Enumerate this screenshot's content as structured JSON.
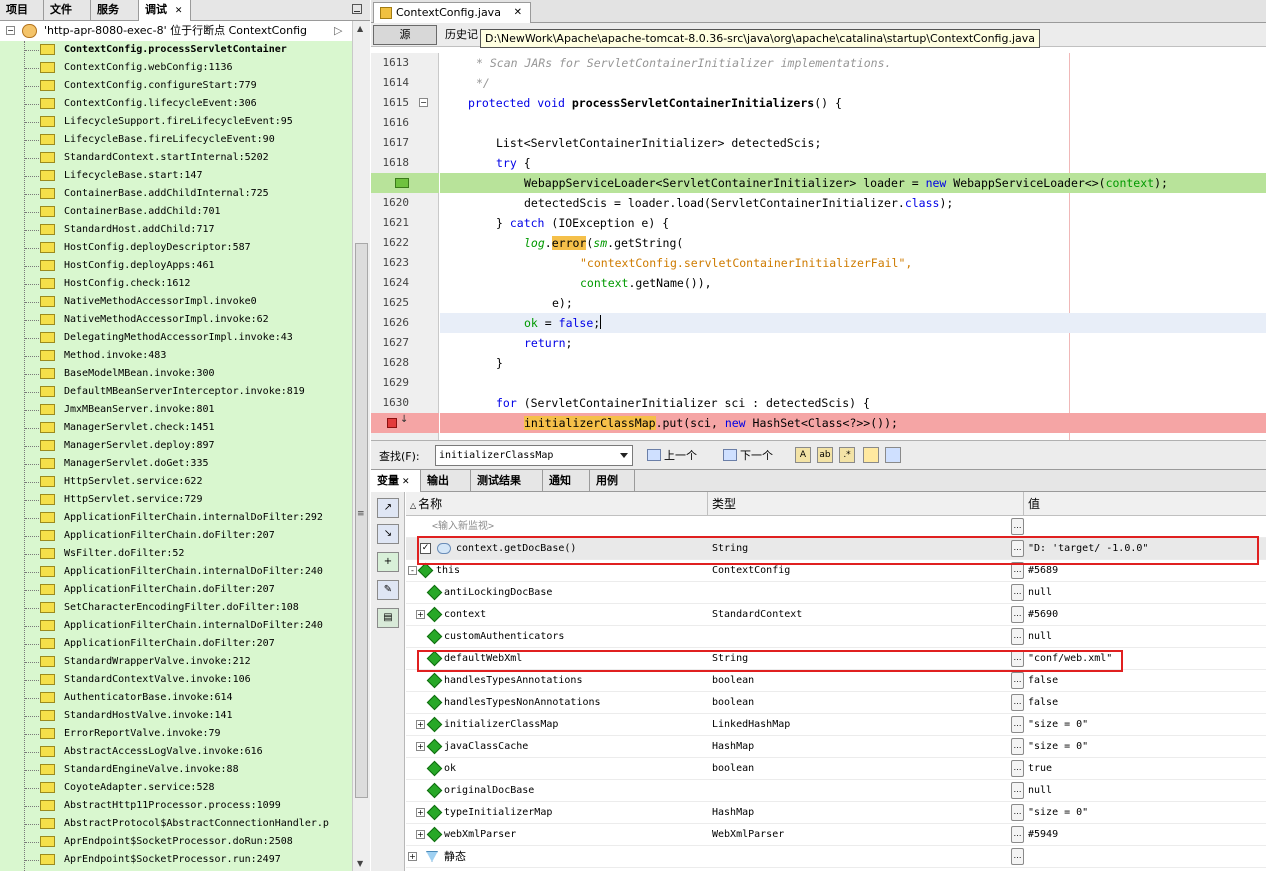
{
  "left_tabs": [
    "项目",
    "文件",
    "服务",
    "调试"
  ],
  "thread": "'http-apr-8080-exec-8' 位于行断点 ContextConfig",
  "frames": [
    "ContextConfig.processServletContainer",
    "ContextConfig.webConfig:1136",
    "ContextConfig.configureStart:779",
    "ContextConfig.lifecycleEvent:306",
    "LifecycleSupport.fireLifecycleEvent:95",
    "LifecycleBase.fireLifecycleEvent:90",
    "StandardContext.startInternal:5202",
    "LifecycleBase.start:147",
    "ContainerBase.addChildInternal:725",
    "ContainerBase.addChild:701",
    "StandardHost.addChild:717",
    "HostConfig.deployDescriptor:587",
    "HostConfig.deployApps:461",
    "HostConfig.check:1612",
    "NativeMethodAccessorImpl.invoke0",
    "NativeMethodAccessorImpl.invoke:62",
    "DelegatingMethodAccessorImpl.invoke:43",
    "Method.invoke:483",
    "BaseModelMBean.invoke:300",
    "DefaultMBeanServerInterceptor.invoke:819",
    "JmxMBeanServer.invoke:801",
    "ManagerServlet.check:1451",
    "ManagerServlet.deploy:897",
    "ManagerServlet.doGet:335",
    "HttpServlet.service:622",
    "HttpServlet.service:729",
    "ApplicationFilterChain.internalDoFilter:292",
    "ApplicationFilterChain.doFilter:207",
    "WsFilter.doFilter:52",
    "ApplicationFilterChain.internalDoFilter:240",
    "ApplicationFilterChain.doFilter:207",
    "SetCharacterEncodingFilter.doFilter:108",
    "ApplicationFilterChain.internalDoFilter:240",
    "ApplicationFilterChain.doFilter:207",
    "StandardWrapperValve.invoke:212",
    "StandardContextValve.invoke:106",
    "AuthenticatorBase.invoke:614",
    "StandardHostValve.invoke:141",
    "ErrorReportValve.invoke:79",
    "AbstractAccessLogValve.invoke:616",
    "StandardEngineValve.invoke:88",
    "CoyoteAdapter.service:528",
    "AbstractHttp11Processor.process:1099",
    "AbstractProtocol$AbstractConnectionHandler.p",
    "AprEndpoint$SocketProcessor.doRun:2508",
    "AprEndpoint$SocketProcessor.run:2497"
  ],
  "editor": {
    "tab_title": "ContextConfig.java",
    "source_label": "源",
    "history_label": "历史记",
    "tooltip_path": "D:\\NewWork\\Apache\\apache-tomcat-8.0.36-src\\java\\org\\apache\\catalina\\startup\\ContextConfig.java",
    "line_numbers": [
      "1613",
      "1614",
      "1615",
      "1616",
      "1617",
      "1618",
      "",
      "1620",
      "1621",
      "1622",
      "1623",
      "1624",
      "1625",
      "1626",
      "1627",
      "1628",
      "1629",
      "1630",
      ""
    ]
  },
  "code": {
    "l1613": "* Scan JARs for ServletContainerInitializer implementations.",
    "l1614": "*/",
    "l1615_kw": "protected void ",
    "l1615_name": "processServletContainerInitializers",
    "l1615_rest": "() {",
    "l1617": "List<ServletContainerInitializer> detectedScis;",
    "l1618_kw": "try",
    "l1618_rest": " {",
    "l1619_a": "WebappServiceLoader<ServletContainerInitializer> loader = ",
    "l1619_new": "new",
    "l1619_b": " WebappServiceLoader<>(",
    "l1619_ctx": "context",
    "l1619_c": ");",
    "l1620_a": "detectedScis = loader.load(ServletContainerInitializer.",
    "l1620_cls": "class",
    "l1620_b": ");",
    "l1621_a": "} ",
    "l1621_kw": "catch",
    "l1621_b": " (IOException e) {",
    "l1622_log": "log",
    "l1622_dot": ".",
    "l1622_err": "error",
    "l1622_p": "(",
    "l1622_sm": "sm",
    "l1622_rest": ".getString(",
    "l1623": "\"contextConfig.servletContainerInitializerFail\",",
    "l1624_ctx": "context",
    "l1624_rest": ".getName()),",
    "l1625": "e);",
    "l1626_ok": "ok",
    "l1626_eq": " = ",
    "l1626_false": "false",
    "l1626_semi": ";",
    "l1627_kw": "return",
    "l1627_semi": ";",
    "l1628": "}",
    "l1630_kw": "for",
    "l1630_rest": " (ServletContainerInitializer sci : detectedScis) {",
    "l1631_hl": "initializerClassMap",
    "l1631_a": ".put(sci, ",
    "l1631_new": "new",
    "l1631_b": " HashSet<Class<?>>());"
  },
  "find": {
    "label": "查找(F):",
    "value": "initializerClassMap",
    "prev": "上一个",
    "next": "下一个"
  },
  "bottom_tabs": [
    "变量",
    "输出",
    "测试结果",
    "通知",
    "用例"
  ],
  "var_headers": {
    "name": "名称",
    "type": "类型",
    "value": "值"
  },
  "new_watch": "<输入新监视>",
  "variables": [
    {
      "name": "context.getDocBase()",
      "type": "String",
      "value": "\"D:                    'target/          -1.0.0\"",
      "watch": true,
      "checked": true
    },
    {
      "name": "this",
      "type": "ContextConfig",
      "value": "#5689",
      "expand": "-",
      "root": true
    },
    {
      "name": "antiLockingDocBase",
      "type": "",
      "value": "null"
    },
    {
      "name": "context",
      "type": "StandardContext",
      "value": "#5690",
      "expand": "+"
    },
    {
      "name": "customAuthenticators",
      "type": "",
      "value": "null"
    },
    {
      "name": "defaultWebXml",
      "type": "String",
      "value": "\"conf/web.xml\""
    },
    {
      "name": "handlesTypesAnnotations",
      "type": "boolean",
      "value": "false"
    },
    {
      "name": "handlesTypesNonAnnotations",
      "type": "boolean",
      "value": "false"
    },
    {
      "name": "initializerClassMap",
      "type": "LinkedHashMap",
      "value": "\"size = 0\"",
      "expand": "+"
    },
    {
      "name": "javaClassCache",
      "type": "HashMap",
      "value": "\"size = 0\"",
      "expand": "+"
    },
    {
      "name": "ok",
      "type": "boolean",
      "value": "true"
    },
    {
      "name": "originalDocBase",
      "type": "",
      "value": "null"
    },
    {
      "name": "typeInitializerMap",
      "type": "HashMap",
      "value": "\"size = 0\"",
      "expand": "+"
    },
    {
      "name": "webXmlParser",
      "type": "WebXmlParser",
      "value": "#5949",
      "expand": "+"
    },
    {
      "name": "静态",
      "type": "",
      "value": "",
      "expand": "+",
      "static": true
    }
  ]
}
